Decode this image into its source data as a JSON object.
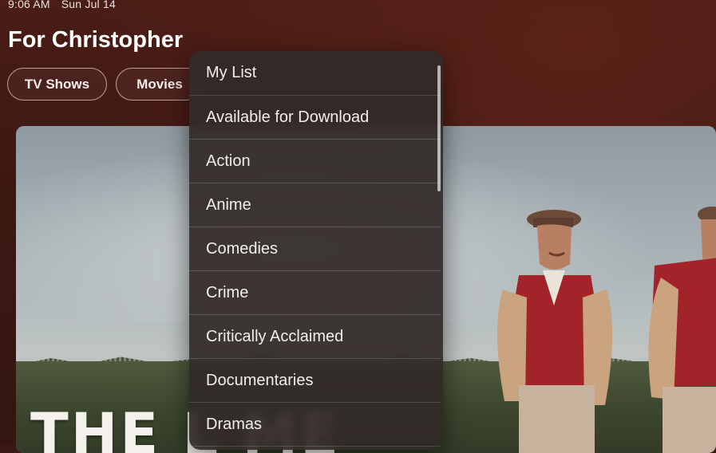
{
  "status_bar": {
    "time": "9:06 AM",
    "date": "Sun Jul 14"
  },
  "header": {
    "title": "For Christopher"
  },
  "chips": [
    {
      "label": "TV Shows"
    },
    {
      "label": "Movies"
    }
  ],
  "hero": {
    "title_text": "THE L                 ME"
  },
  "menu": {
    "items": [
      {
        "label": "My List"
      },
      {
        "label": "Available for Download"
      },
      {
        "label": "Action"
      },
      {
        "label": "Anime"
      },
      {
        "label": "Comedies"
      },
      {
        "label": "Crime"
      },
      {
        "label": "Critically Acclaimed"
      },
      {
        "label": "Documentaries"
      },
      {
        "label": "Dramas"
      }
    ]
  },
  "colors": {
    "background": "#3a1712",
    "menu_bg": "#322a28",
    "jacket_red": "#a3232a",
    "sleeve_tan": "#c9a47e"
  }
}
